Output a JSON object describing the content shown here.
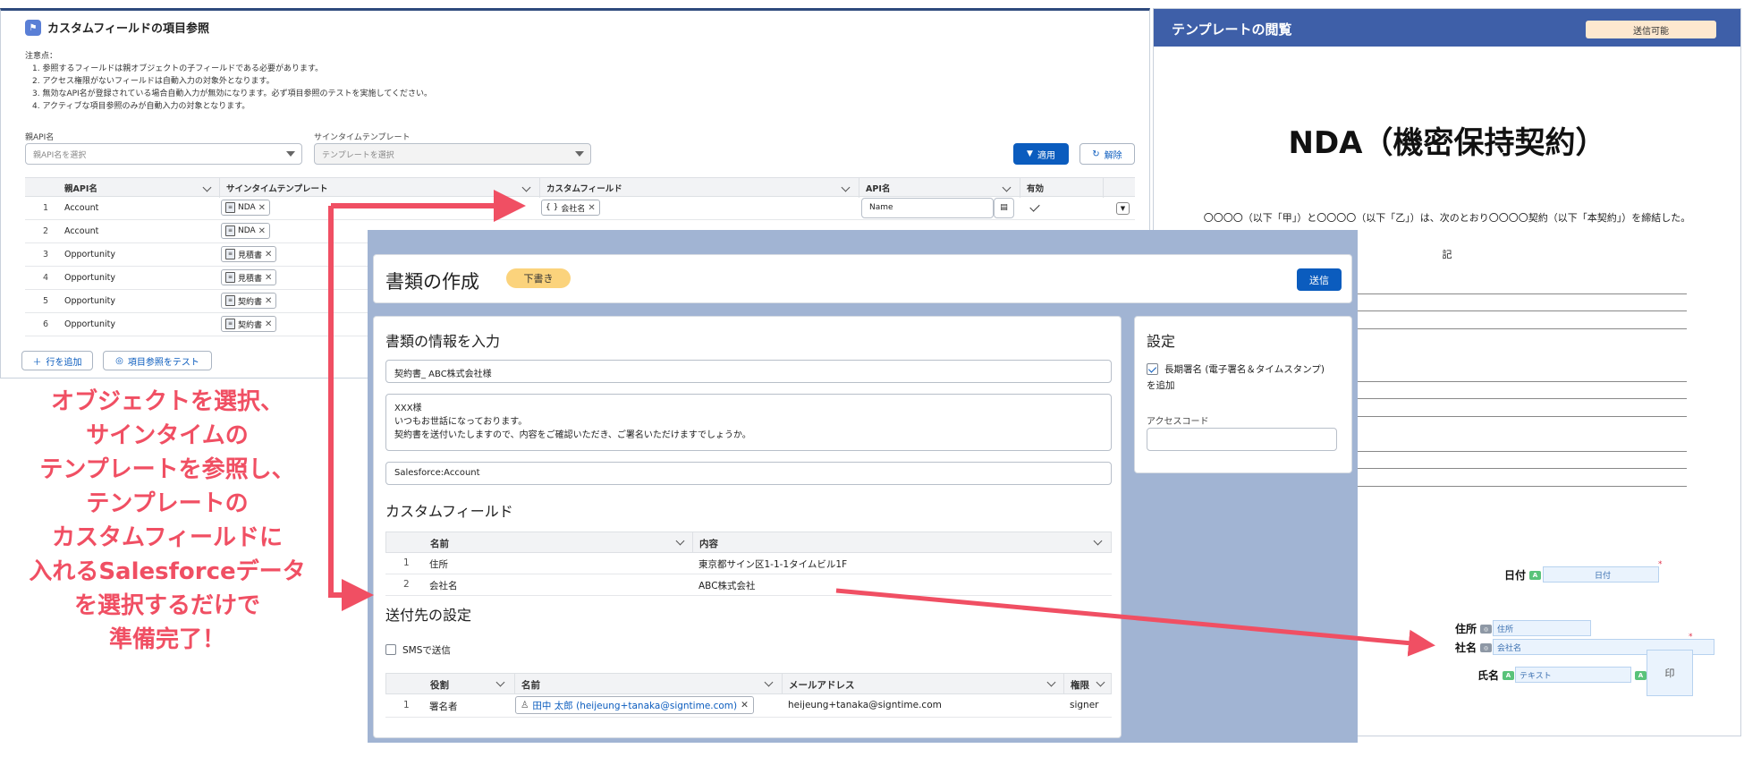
{
  "ref_panel": {
    "title": "カスタムフィールドの項目参照",
    "notes_title": "注意点：",
    "notes": [
      "1. 参照するフィールドは親オブジェクトの子フィールドである必要があります。",
      "2. アクセス権限がないフィールドは自動入力の対象外となります。",
      "3. 無効なAPI名が登録されている場合自動入力が無効になります。必ず項目参照のテストを実施してください。",
      "4. アクティブな項目参照のみが自動入力の対象となります。"
    ],
    "parent_api_label": "親API名",
    "parent_api_placeholder": "親API名を選択",
    "template_label": "サインタイムテンプレート",
    "template_placeholder": "テンプレートを選択",
    "apply_label": "適用",
    "clear_label": "解除",
    "columns": [
      "親API名",
      "サインタイムテンプレート",
      "カスタムフィールド",
      "API名",
      "有効"
    ],
    "rows": [
      {
        "num": "1",
        "parent": "Account",
        "template": "NDA",
        "field": "会社名",
        "api": "Name"
      },
      {
        "num": "2",
        "parent": "Account",
        "template": "NDA",
        "field": "",
        "api": ""
      },
      {
        "num": "3",
        "parent": "Opportunity",
        "template": "見積書",
        "field": "",
        "api": ""
      },
      {
        "num": "4",
        "parent": "Opportunity",
        "template": "見積書",
        "field": "",
        "api": ""
      },
      {
        "num": "5",
        "parent": "Opportunity",
        "template": "契約書",
        "field": "",
        "api": ""
      },
      {
        "num": "6",
        "parent": "Opportunity",
        "template": "契約書",
        "field": "",
        "api": ""
      }
    ],
    "add_row_label": "行を追加",
    "test_label": "項目参照をテスト"
  },
  "template_panel": {
    "title": "テンプレートの閲覧",
    "status": "送信可能",
    "doc_title": "NDA（機密保持契約）",
    "intro": "〇〇〇〇（以下「甲」）と〇〇〇〇（以下「乙」）は、次のとおり〇〇〇〇契約（以下「本契約」）を締結した。",
    "ki": "記",
    "date_label": "日付",
    "date_field": "日付",
    "address_label": "住所",
    "address_field": "住所",
    "company_label": "社名",
    "company_field": "会社名",
    "name_label": "氏名",
    "name_field": "テキスト",
    "stamp": "印",
    "badge_a": "A"
  },
  "create_panel": {
    "title": "書類の作成",
    "draft": "下書き",
    "send": "送信",
    "info_title": "書類の情報を入力",
    "doc_name": "契約書_ ABC株式会社様",
    "message": [
      "XXX様",
      "いつもお世話になっております。",
      "契約書を送付いたしますので、内容をご確認いただき、ご署名いただけますでしょうか。"
    ],
    "object_ref": "Salesforce:Account",
    "custom_title": "カスタムフィールド",
    "custom_cols": [
      "名前",
      "内容"
    ],
    "custom_rows": [
      {
        "num": "1",
        "name": "住所",
        "value": "東京都サイン区1-1-1タイムビル1F"
      },
      {
        "num": "2",
        "name": "会社名",
        "value": "ABC株式会社"
      }
    ],
    "recipient_title": "送付先の設定",
    "sms_label": "SMSで送信",
    "recipient_cols": [
      "役割",
      "名前",
      "メールアドレス",
      "権限"
    ],
    "recipient_rows": [
      {
        "num": "1",
        "role": "署名者",
        "name": "田中 太郎 (heijeung+tanaka@signtime.com)",
        "email": "heijeung+tanaka@signtime.com",
        "perm": "signer"
      }
    ],
    "settings_title": "設定",
    "long_term_line1": "長期署名 (電子署名＆タイムスタンプ)",
    "long_term_line2": "を追加",
    "access_code_label": "アクセスコード"
  },
  "caption": {
    "lines": [
      "オブジェクトを選択、",
      "サインタイムの",
      "テンプレートを参照し、",
      "テンプレートの",
      "カスタムフィールドに",
      "入れるSalesforceデータ",
      "を選択するだけで",
      "準備完了！"
    ]
  },
  "colors": {
    "accent_red": "#f04f63",
    "brand_blue": "#0b5cbe",
    "header_blue": "#3e5fa8",
    "panel_bg": "#a1b4d3"
  }
}
